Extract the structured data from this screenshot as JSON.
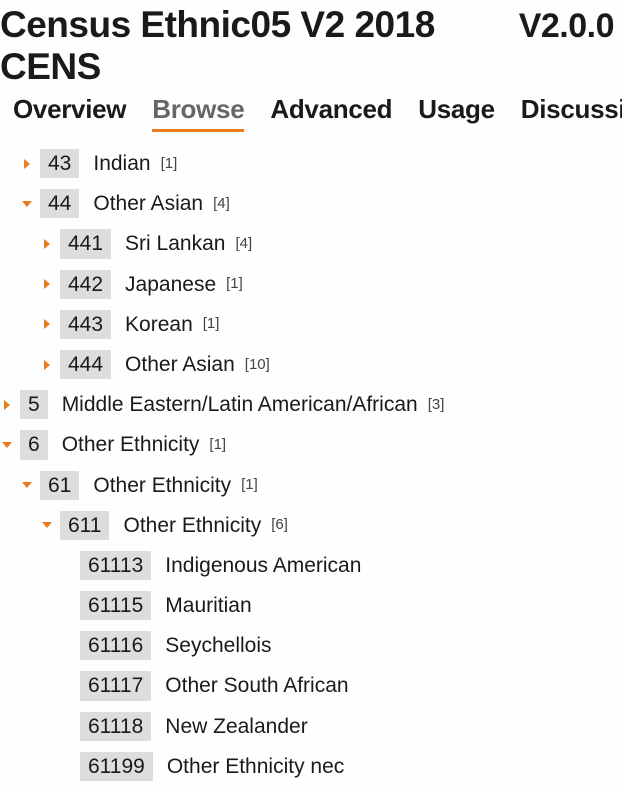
{
  "header": {
    "title": "Census Ethnic05 V2 2018 CENS",
    "version": "V2.0.0"
  },
  "tabs": [
    {
      "id": "overview",
      "label": "Overview",
      "active": false
    },
    {
      "id": "browse",
      "label": "Browse",
      "active": true
    },
    {
      "id": "advanced",
      "label": "Advanced",
      "active": false
    },
    {
      "id": "usage",
      "label": "Usage",
      "active": false
    },
    {
      "id": "discussion",
      "label": "Discussion",
      "active": false
    }
  ],
  "tree": [
    {
      "level": 2,
      "arrow": "right",
      "code": "43",
      "label": "Indian",
      "count": "[1]"
    },
    {
      "level": 2,
      "arrow": "down",
      "code": "44",
      "label": "Other Asian",
      "count": "[4]"
    },
    {
      "level": 3,
      "arrow": "right",
      "code": "441",
      "label": "Sri Lankan",
      "count": "[4]"
    },
    {
      "level": 3,
      "arrow": "right",
      "code": "442",
      "label": "Japanese",
      "count": "[1]"
    },
    {
      "level": 3,
      "arrow": "right",
      "code": "443",
      "label": "Korean",
      "count": "[1]"
    },
    {
      "level": 3,
      "arrow": "right",
      "code": "444",
      "label": "Other Asian",
      "count": "[10]"
    },
    {
      "level": 1,
      "arrow": "right",
      "code": "5",
      "label": "Middle Eastern/Latin American/African",
      "count": "[3]"
    },
    {
      "level": 1,
      "arrow": "down",
      "code": "6",
      "label": "Other Ethnicity",
      "count": "[1]"
    },
    {
      "level": 2,
      "arrow": "down",
      "code": "61",
      "label": "Other Ethnicity",
      "count": "[1]"
    },
    {
      "level": 3,
      "arrow": "down",
      "code": "611",
      "label": "Other Ethnicity",
      "count": "[6]"
    },
    {
      "level": 4,
      "arrow": "none",
      "code": "61113",
      "label": "Indigenous American",
      "count": ""
    },
    {
      "level": 4,
      "arrow": "none",
      "code": "61115",
      "label": "Mauritian",
      "count": ""
    },
    {
      "level": 4,
      "arrow": "none",
      "code": "61116",
      "label": "Seychellois",
      "count": ""
    },
    {
      "level": 4,
      "arrow": "none",
      "code": "61117",
      "label": "Other South African",
      "count": ""
    },
    {
      "level": 4,
      "arrow": "none",
      "code": "61118",
      "label": "New Zealander",
      "count": ""
    },
    {
      "level": 4,
      "arrow": "none",
      "code": "61199",
      "label": "Other Ethnicity nec",
      "count": ""
    }
  ]
}
